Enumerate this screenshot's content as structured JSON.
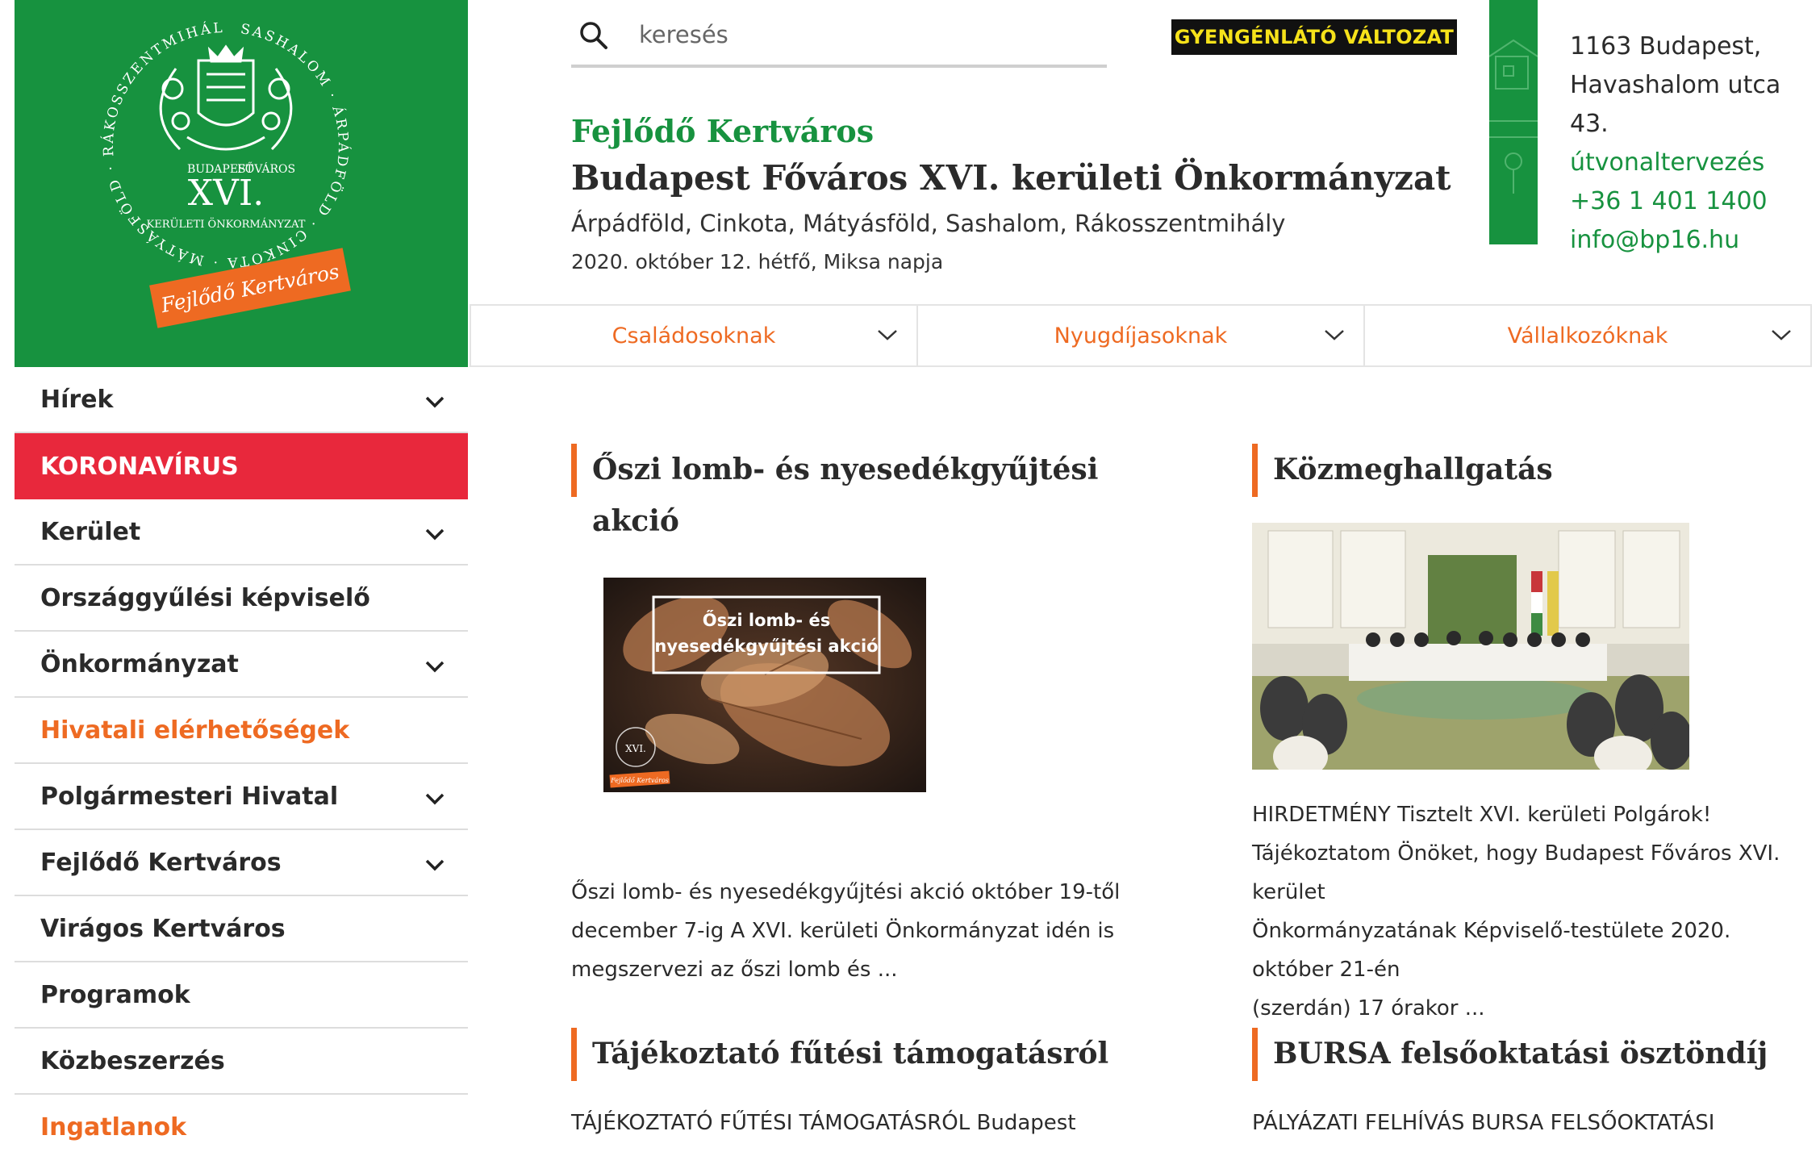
{
  "logo": {
    "ring_text": "SASHALOM · ÁRPÁDFÖLD · CINKOTA · MÁTYÁSFÖLD · RÁKOSSZENTMIHÁLY",
    "city": "BUDAPEST",
    "capital": "FŐVÁROS",
    "numeral": "XVI.",
    "sub": "KERÜLETI ÖNKORMÁNYZAT",
    "ribbon": "Fejlődő Kertváros",
    "colors": {
      "bg": "#17923f",
      "ribbon": "#ee6a22"
    }
  },
  "search": {
    "placeholder": "keresés",
    "icon": "search-icon"
  },
  "low_vision_label": "GYENGÉNLÁTÓ VÁLTOZAT",
  "header": {
    "tagline": "Fejlődő Kertváros",
    "title": "Budapest Főváros XVI. kerületi Önkormányzat",
    "districts": "Árpádföld, Cinkota, Mátyásföld, Sashalom, Rákosszentmihály",
    "date": "2020. október 12. hétfő, Miksa napja"
  },
  "contact": {
    "address_line1": "1163 Budapest,",
    "address_line2": "Havashalom utca 43.",
    "route": "útvonaltervezés",
    "phone": "+36 1 401 1400",
    "email": "info@bp16.hu"
  },
  "audience_tabs": [
    {
      "label": "Családosoknak"
    },
    {
      "label": "Nyugdíjasoknak"
    },
    {
      "label": "Vállalkozóknak"
    }
  ],
  "sidebar": {
    "items": [
      {
        "label": "Hírek",
        "expandable": true,
        "style": "normal"
      },
      {
        "label": "KORONAVÍRUS",
        "expandable": false,
        "style": "highlight"
      },
      {
        "label": "Kerület",
        "expandable": true,
        "style": "normal"
      },
      {
        "label": "Országgyűlési képviselő",
        "expandable": false,
        "style": "normal"
      },
      {
        "label": "Önkormányzat",
        "expandable": true,
        "style": "normal"
      },
      {
        "label": "Hivatali elérhetőségek",
        "expandable": false,
        "style": "accent"
      },
      {
        "label": "Polgármesteri Hivatal",
        "expandable": true,
        "style": "normal"
      },
      {
        "label": "Fejlődő Kertváros",
        "expandable": true,
        "style": "normal"
      },
      {
        "label": "Virágos Kertváros",
        "expandable": false,
        "style": "normal"
      },
      {
        "label": "Programok",
        "expandable": false,
        "style": "normal"
      },
      {
        "label": "Közbeszerzés",
        "expandable": false,
        "style": "normal"
      },
      {
        "label": "Ingatlanok",
        "expandable": false,
        "style": "accent"
      }
    ]
  },
  "articles": [
    {
      "title": "Őszi lomb- és nyesedékgyűjtési akció",
      "image_caption": [
        "Őszi lomb- és",
        "nyesedékgyűjtési akció"
      ],
      "image_logo_numeral": "XVI.",
      "image_ribbon": "Fejlődő Kertváros",
      "excerpt_lines": [
        "Őszi lomb- és nyesedékgyűjtési akció október 19-től",
        "december 7-ig A XVI. kerületi Önkormányzat idén is",
        "megszervezi az őszi lomb és ..."
      ]
    },
    {
      "title": "Közmeghallgatás",
      "excerpt_lines": [
        "HIRDETMÉNY Tisztelt XVI. kerületi Polgárok!",
        "Tájékoztatom Önöket, hogy Budapest Főváros XVI. kerület",
        "Önkormányzatának Képviselő-testülete 2020. október 21-én",
        "(szerdán) 17 órakor ..."
      ]
    },
    {
      "title": "Tájékoztató fűtési támogatásról",
      "excerpt_lines": [
        "TÁJÉKOZTATÓ FŰTÉSI TÁMOGATÁSRÓL Budapest"
      ]
    },
    {
      "title": "BURSA felsőoktatási ösztöndíj",
      "excerpt_lines": [
        "PÁLYÁZATI FELHÍVÁS BURSA FELSŐOKTATÁSI"
      ]
    }
  ],
  "colors": {
    "brand_green": "#17923f",
    "accent_orange": "#ee6a22",
    "alert_red": "#e8283c",
    "low_vision_bg": "#111111",
    "low_vision_text": "#f6e21a"
  }
}
